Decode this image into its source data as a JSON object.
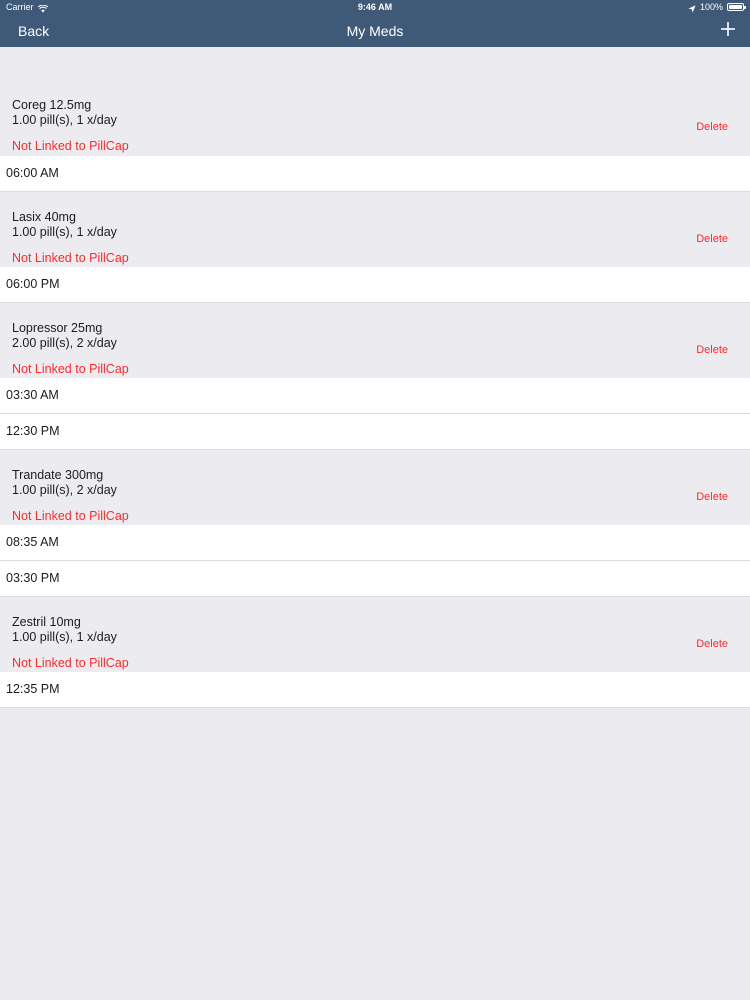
{
  "status_bar": {
    "carrier": "Carrier",
    "time": "9:46 AM",
    "battery": "100%",
    "battery_level": 1.0
  },
  "nav": {
    "back_label": "Back",
    "title": "My Meds",
    "add_icon": "plus-icon"
  },
  "colors": {
    "nav_background": "#3f5a78",
    "page_background": "#ebebf0",
    "warning_red": "#ff2a2a"
  },
  "meds": [
    {
      "name": "Coreg 12.5mg",
      "dosage": "1.00 pill(s), 1 x/day",
      "link_status": "Not Linked to PillCap",
      "delete_label": "Delete",
      "times": [
        "06:00 AM"
      ]
    },
    {
      "name": "Lasix 40mg",
      "dosage": "1.00 pill(s), 1 x/day",
      "link_status": "Not Linked to PillCap",
      "delete_label": "Delete",
      "times": [
        "06:00 PM"
      ]
    },
    {
      "name": "Lopressor 25mg",
      "dosage": "2.00 pill(s), 2 x/day",
      "link_status": "Not Linked to PillCap",
      "delete_label": "Delete",
      "times": [
        "03:30 AM",
        "12:30 PM"
      ]
    },
    {
      "name": "Trandate 300mg",
      "dosage": "1.00 pill(s), 2 x/day",
      "link_status": "Not Linked to PillCap",
      "delete_label": "Delete",
      "times": [
        "08:35 AM",
        "03:30 PM"
      ]
    },
    {
      "name": "Zestril 10mg",
      "dosage": "1.00 pill(s), 1 x/day",
      "link_status": "Not Linked to PillCap",
      "delete_label": "Delete",
      "times": [
        "12:35 PM"
      ]
    }
  ]
}
